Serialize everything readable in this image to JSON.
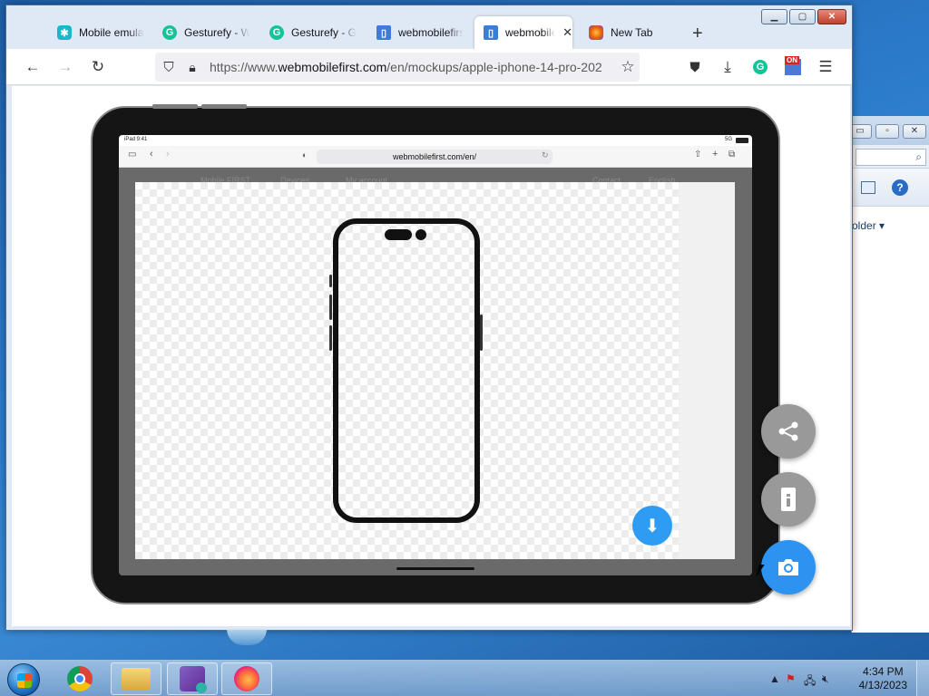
{
  "browser": {
    "tabs": [
      {
        "label": "Mobile emula",
        "icon": "puzzle-icon",
        "color": "#1ab6c9",
        "active": false
      },
      {
        "label": "Gesturefy - W",
        "icon": "grammarly-icon",
        "color": "#15c39a",
        "active": false
      },
      {
        "label": "Gesturefy - Ge",
        "icon": "grammarly-icon",
        "color": "#15c39a",
        "active": false
      },
      {
        "label": "webmobilefirs",
        "icon": "page-icon",
        "color": "#3d7bd9",
        "active": false
      },
      {
        "label": "webmobile",
        "icon": "page-icon",
        "color": "#3d7bd9",
        "active": true
      },
      {
        "label": "New Tab",
        "icon": "firefox-icon",
        "color": "#e66000",
        "active": false
      }
    ],
    "new_tab_symbol": "+",
    "url_prefix": "https://www.",
    "url_host": "webmobilefirst.com",
    "url_path": "/en/mockups/apple-iphone-14-pro-202",
    "extension_badge": "ON"
  },
  "ipad": {
    "status_left": "iPad 9:41",
    "status_right": "5G",
    "address": "webmobilefirst.com/en/",
    "nav_items": [
      "Mobile FIRST",
      "Devices",
      "My account",
      "Contact",
      "English"
    ]
  },
  "fabs": {
    "share": "share-icon",
    "info": "phone-icon",
    "camera": "camera-icon"
  },
  "background_window": {
    "folder_label": "older ▾"
  },
  "taskbar": {
    "time": "4:34 PM",
    "date": "4/13/2023",
    "apps": [
      "chrome-icon",
      "explorer-icon",
      "visual-studio-installer-icon",
      "firefox-icon"
    ]
  },
  "colors": {
    "accent": "#2d93f0",
    "download": "#2d9cf2",
    "fab_gray": "#999999"
  }
}
